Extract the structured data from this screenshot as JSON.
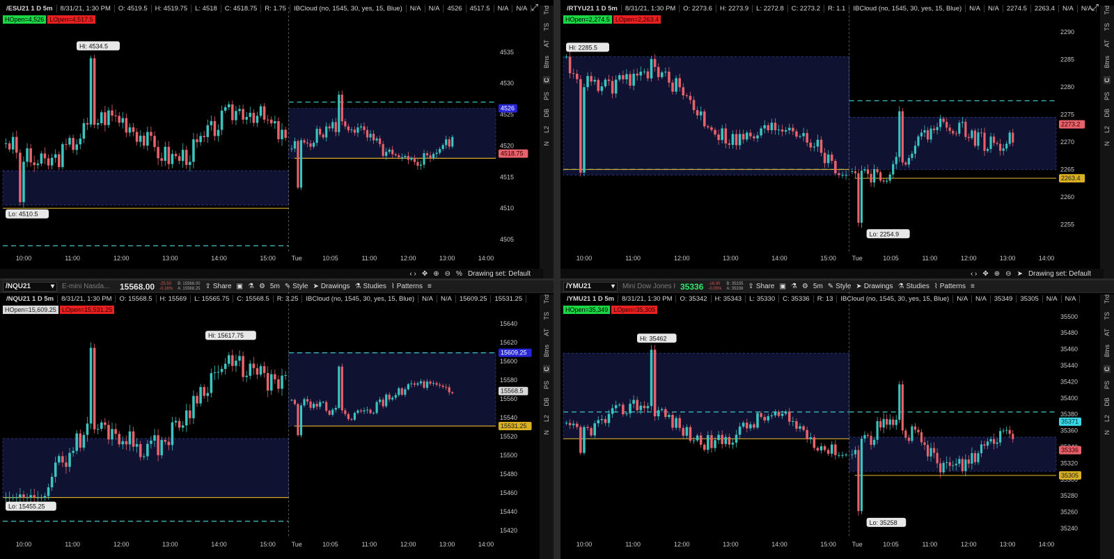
{
  "colors": {
    "bull": "#3bc4c0",
    "bear": "#e8626c",
    "box": "#0f1230",
    "dash": "#3aa8a8",
    "bluedash": "#3c50b0",
    "open": "#d4aa30",
    "axis": "#c8c8c8"
  },
  "charts": [
    {
      "id": "es",
      "toolbar": null,
      "info": {
        "symbol": "/ESU21 1 D 5m",
        "date": "8/31/21, 1:30 PM",
        "o": "O: 4519.5",
        "h": "H: 4519.75",
        "l": "L: 4518",
        "c": "C: 4518.75",
        "r": "R: 1.75",
        "cloud": "IBCloud (no, 1545, 30, yes, 15, Blue)",
        "na1": "N/A",
        "na2": "N/A",
        "blue": "4526",
        "yellow": "4517.5",
        "na3": "N/A",
        "na4": "N/A"
      },
      "hopen": "HOpen=4,526",
      "lopen": "LOpen=4,517.5",
      "hi_label": "Hi: 4534.5",
      "lo_label": "Lo: 4510.5",
      "y_ticks": [
        "4535",
        "4530",
        "4525",
        "4520",
        "4515",
        "4510",
        "4505"
      ],
      "y_range": [
        4503,
        4540
      ],
      "ov_start": 4520.5,
      "ov_close": 4522.5,
      "ov_hi": 4534.5,
      "ov_lo": 4510.5,
      "box1": [
        4510.5,
        4516
      ],
      "box2": [
        4518,
        4526
      ],
      "dash_hi": 4527,
      "dash_lo": 4504,
      "open_line": 4510,
      "open_line2": 4518,
      "rt_start": 4522,
      "rt_close": 4518.75,
      "rt_hi": 4528.5,
      "rt_lo": 4513,
      "price_tags": [
        {
          "text": "4526",
          "bg": "#2626d8",
          "fg": "#fff",
          "value": 4526
        },
        {
          "text": "4518.75",
          "bg": "#e8626c",
          "fg": "#300",
          "value": 4518.75
        }
      ],
      "x_ticks": [
        "10:00",
        "11:00",
        "12:00",
        "13:00",
        "14:00",
        "15:00",
        "Tue",
        "10:05",
        "11:00",
        "12:00",
        "13:00",
        "14:00"
      ],
      "side_tabs": [
        "Trd",
        "TS",
        "AT",
        "Btns",
        "C",
        "PS",
        "DB",
        "L2",
        "N"
      ],
      "bottom": {
        "drawing_set": "Drawing set: Default",
        "percent": "%"
      }
    },
    {
      "id": "rty",
      "toolbar": null,
      "info": {
        "symbol": "/RTYU21 1 D 5m",
        "date": "8/31/21, 1:30 PM",
        "o": "O: 2273.6",
        "h": "H: 2273.9",
        "l": "L: 2272.8",
        "c": "C: 2273.2",
        "r": "R: 1.1",
        "cloud": "IBCloud (no, 1545, 30, yes, 15, Blue)",
        "na1": "N/A",
        "na2": "N/A",
        "blue": "2274.5",
        "yellow": "2263.4",
        "na3": "N/A",
        "na4": "N/A"
      },
      "hopen": "HOpen=2,274.5",
      "lopen": "LOpen=2,263.4",
      "hi_label": "Hi: 2285.5",
      "lo_label": "Lo: 2254.9",
      "y_ticks": [
        "2290",
        "2285",
        "2280",
        "2275",
        "2270",
        "2265",
        "2260",
        "2255"
      ],
      "y_range": [
        2250,
        2292
      ],
      "ov_start": 2285.5,
      "ov_close": 2265.5,
      "ov_hi": 2285.5,
      "ov_lo": 2264,
      "box1": [
        2264,
        2285.5
      ],
      "box2": [
        2265,
        2274.5
      ],
      "dash_hi": 2277.5,
      "dash_lo": 2265,
      "open_line": 2265,
      "open_line2": 2263.4,
      "rt_start": 2266,
      "rt_close": 2273.2,
      "rt_hi": 2276,
      "rt_lo": 2254.9,
      "price_tags": [
        {
          "text": "2273.2",
          "bg": "#e8626c",
          "fg": "#300",
          "value": 2273.2
        },
        {
          "text": "2263.4",
          "bg": "#d8b020",
          "fg": "#222",
          "value": 2263.4
        }
      ],
      "x_ticks": [
        "10:00",
        "11:00",
        "12:00",
        "13:00",
        "14:00",
        "15:00",
        "Tue",
        "10:05",
        "11:00",
        "12:00",
        "13:00",
        "14:00"
      ],
      "side_tabs": [
        "Trd",
        "TS",
        "AT",
        "Btns",
        "C",
        "PS",
        "DB",
        "L2",
        "N"
      ],
      "bottom": {
        "drawing_set": "Drawing set: Default",
        "percent": ""
      }
    },
    {
      "id": "nq",
      "toolbar": {
        "symbol": "/NQU21",
        "desc": "E-mini Nasda...",
        "price": "15568.00",
        "chg1": "-25.50",
        "chg2": "-0.16%",
        "bid": "B: 15568.00",
        "ask": "A: 15568.25",
        "share": "Share",
        "tf": "5m",
        "style": "Style",
        "drawings": "Drawings",
        "studies": "Studies",
        "patterns": "Patterns",
        "green": false
      },
      "info": {
        "symbol": "/NQU21 1 D 5m",
        "date": "8/31/21, 1:30 PM",
        "o": "O: 15568.5",
        "h": "H: 15569",
        "l": "L: 15565.75",
        "c": "C: 15568.5",
        "r": "R: 3.25",
        "cloud": "IBCloud (no, 1545, 30, yes, 15, Blue)",
        "na1": "N/A",
        "na2": "N/A",
        "blue": "15609.25",
        "yellow": "15531.25",
        "na3": "",
        "na4": ""
      },
      "hopen": "HOpen=15,609.25",
      "lopen": "LOpen=15,531.25",
      "hi_label": "Hi: 15617.75",
      "lo_label": "Lo: 15455.25",
      "y_ticks": [
        "15640",
        "15620",
        "15600",
        "15580",
        "15560",
        "15540",
        "15520",
        "15500",
        "15480",
        "15460",
        "15440",
        "15420"
      ],
      "y_range": [
        15412,
        15652
      ],
      "ov_start": 15460,
      "ov_close": 15600,
      "ov_hi": 15617.75,
      "ov_lo": 15455.25,
      "box1": [
        15455.25,
        15518
      ],
      "box2": [
        15531.25,
        15609.25
      ],
      "dash_hi": 15609.25,
      "dash_lo": 15430,
      "open_line": 15455.25,
      "open_line2": 15531.25,
      "rt_start": 15545,
      "rt_close": 15568.5,
      "rt_hi": 15596,
      "rt_lo": 15520,
      "price_tags": [
        {
          "text": "15609.25",
          "bg": "#2626d8",
          "fg": "#fff",
          "value": 15609.25
        },
        {
          "text": "15568.5",
          "bg": "#d9d9d9",
          "fg": "#222",
          "value": 15568.5
        },
        {
          "text": "15531.25",
          "bg": "#d8b020",
          "fg": "#222",
          "value": 15531.25
        }
      ],
      "x_ticks": [
        "10:00",
        "11:00",
        "12:00",
        "13:00",
        "14:00",
        "15:00",
        "Tue",
        "10:05",
        "11:00",
        "12:00",
        "13:00",
        "14:00"
      ],
      "side_tabs": [
        "Trd",
        "TS",
        "AT",
        "Btns",
        "C",
        "PS",
        "DB",
        "L2",
        "N"
      ],
      "bottom": null
    },
    {
      "id": "ym",
      "toolbar": {
        "symbol": "/YMU21",
        "desc": "Mini Dow Jones Ind...",
        "price": "35336",
        "chg1": "-16.00",
        "chg2": "-0.05%",
        "bid": "B: 35335",
        "ask": "A: 35336",
        "share": "Share",
        "tf": "5m",
        "style": "Style",
        "drawings": "Drawings",
        "studies": "Studies",
        "patterns": "Patterns",
        "green": true
      },
      "info": {
        "symbol": "/YMU21 1 D 5m",
        "date": "8/31/21, 1:30 PM",
        "o": "O: 35342",
        "h": "H: 35343",
        "l": "L: 35330",
        "c": "C: 35336",
        "r": "R: 13",
        "cloud": "IBCloud (no, 1545, 30, yes, 15, Blue)",
        "na1": "N/A",
        "na2": "N/A",
        "blue": "35349",
        "yellow": "35305",
        "na3": "N/A",
        "na4": "N/A"
      },
      "hopen": "HOpen=35,349",
      "lopen": "LOpen=35,305",
      "hi_label": "Hi: 35462",
      "lo_label": "Lo: 35258",
      "y_ticks": [
        "35500",
        "35480",
        "35460",
        "35440",
        "35420",
        "35400",
        "35380",
        "35360",
        "35340",
        "35320",
        "35300",
        "35280",
        "35260",
        "35240"
      ],
      "y_range": [
        35228,
        35505
      ],
      "ov_start": 35380,
      "ov_close": 35350,
      "ov_hi": 35462,
      "ov_lo": 35330,
      "box1": [
        35350,
        35455
      ],
      "box2": [
        35310,
        35352
      ],
      "dash_hi": 35383,
      "dash_lo": 35383,
      "open_line": 35350,
      "open_line2": 35305,
      "rt_start": 35345,
      "rt_close": 35336,
      "rt_hi": 35420,
      "rt_lo": 35258,
      "price_tags": [
        {
          "text": "35371",
          "bg": "#3bd8e8",
          "fg": "#033",
          "value": 35371
        },
        {
          "text": "35336",
          "bg": "#e8626c",
          "fg": "#300",
          "value": 35336
        },
        {
          "text": "35305",
          "bg": "#d8b020",
          "fg": "#222",
          "value": 35305
        }
      ],
      "x_ticks": [
        "10:00",
        "11:00",
        "12:00",
        "13:00",
        "14:00",
        "15:00",
        "Tue",
        "10:05",
        "11:00",
        "12:00",
        "13:00",
        "14:00"
      ],
      "side_tabs": [
        "Trd",
        "TS",
        "AT",
        "Btns",
        "C",
        "PS",
        "DB",
        "L2",
        "N"
      ],
      "bottom": null
    }
  ]
}
